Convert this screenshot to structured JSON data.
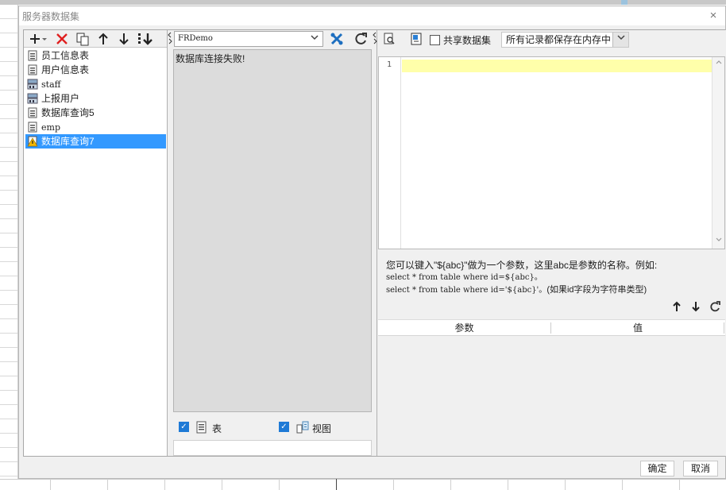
{
  "dialog": {
    "title": "服务器数据集",
    "close_symbol": "×"
  },
  "left_toolbar": {
    "icons": [
      "add-icon",
      "delete-icon",
      "copy-icon",
      "move-up-icon",
      "move-down-icon",
      "sort-icon"
    ]
  },
  "datasets": [
    {
      "label": "员工信息表",
      "icon": "db-table-icon",
      "selected": false
    },
    {
      "label": "用户信息表",
      "icon": "db-table-icon",
      "selected": false
    },
    {
      "label": "staff",
      "icon": "server-table-icon",
      "selected": false
    },
    {
      "label": "上报用户",
      "icon": "server-table-icon",
      "selected": false
    },
    {
      "label": "数据库查询5",
      "icon": "db-table-icon",
      "selected": false
    },
    {
      "label": "emp",
      "icon": "db-table-icon",
      "selected": false
    },
    {
      "label": "数据库查询7",
      "icon": "db-warning-icon",
      "selected": true
    }
  ],
  "middle": {
    "connection": "FRDemo",
    "message": "数据库连接失败!",
    "table_label": "表",
    "view_label": "视图",
    "table_checked": true,
    "view_checked": true
  },
  "right": {
    "share_label": "共享数据集",
    "share_checked": false,
    "storage_option": "所有记录都保存在内存中",
    "line_number": "1",
    "hint_line1": "您可以键入\"${abc}\"做为一个参数，这里abc是参数的名称。例如:",
    "hint_line2": "select * from table where id=${abc}。",
    "hint_line3_code": "select * from table where id='${abc}'。",
    "hint_line3_note": "(如果id字段为字符串类型)",
    "param_col": "参数",
    "value_col": "值"
  },
  "footer": {
    "ok_label": "确定",
    "cancel_label": "取消"
  },
  "colors": {
    "selection": "#3399ff",
    "highlight_line": "#ffffaa",
    "checkbox_blue": "#1e7ad6",
    "delete_red": "#e02020"
  }
}
